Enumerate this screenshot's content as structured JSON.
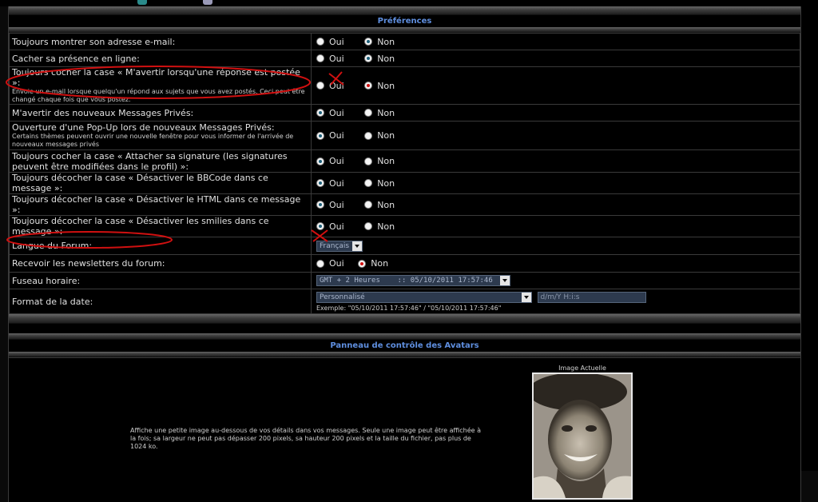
{
  "preferences": {
    "header": "Préférences",
    "rows": [
      {
        "label": "Toujours montrer son adresse e-mail:",
        "desc": "",
        "yes": "Oui",
        "no": "Non",
        "selected": "no"
      },
      {
        "label": "Cacher sa présence en ligne:",
        "desc": "",
        "yes": "Oui",
        "no": "Non",
        "selected": "no"
      },
      {
        "label": "Toujours cocher la case « M'avertir lorsqu'une réponse est postée »:",
        "desc": "Envoie un e-mail lorsque quelqu'un répond aux sujets que vous avez postés. Ceci peut être changé chaque fois que vous postez.",
        "yes": "Oui",
        "no": "Non",
        "selected": "no"
      },
      {
        "label": "M'avertir des nouveaux Messages Privés:",
        "desc": "",
        "yes": "Oui",
        "no": "Non",
        "selected": "yes"
      },
      {
        "label": "Ouverture d'une Pop-Up lors de nouveaux Messages Privés:",
        "desc": "Certains thèmes peuvent ouvrir une nouvelle fenêtre pour vous informer de l'arrivée de nouveaux messages privés",
        "yes": "Oui",
        "no": "Non",
        "selected": "yes"
      },
      {
        "label": "Toujours cocher la case « Attacher sa signature (les signatures peuvent être modifiées dans le profil) »:",
        "desc": "",
        "yes": "Oui",
        "no": "Non",
        "selected": "yes"
      },
      {
        "label": "Toujours décocher la case « Désactiver le BBCode dans ce message »:",
        "desc": "",
        "yes": "Oui",
        "no": "Non",
        "selected": "yes"
      },
      {
        "label": "Toujours décocher la case « Désactiver le HTML dans ce message »:",
        "desc": "",
        "yes": "Oui",
        "no": "Non",
        "selected": "yes"
      },
      {
        "label": "Toujours décocher la case « Désactiver les smilies dans ce message »:",
        "desc": "",
        "yes": "Oui",
        "no": "Non",
        "selected": "yes"
      }
    ],
    "language": {
      "label": "Langue du Forum:",
      "value": "Français"
    },
    "newsletter": {
      "label": "Recevoir les newsletters du forum:",
      "yes": "Oui",
      "no": "Non",
      "selected": "no"
    },
    "timezone": {
      "label": "Fuseau horaire:",
      "value": "GMT + 2 Heures    :: 05/10/2011 17:57:46"
    },
    "dateformat": {
      "label": "Format de la date:",
      "select_value": "Personnalisé",
      "input_value": "d/m/Y H:i:s",
      "example": "Exemple: \"05/10/2011 17:57:46\" / \"05/10/2011 17:57:46\""
    }
  },
  "avatar": {
    "header": "Panneau de contrôle des Avatars",
    "description": "Affiche une petite image au-dessous de vos détails dans vos messages. Seule une image peut être affichée à la fois; sa largeur ne peut pas dépasser 200 pixels, sa hauteur 200 pixels et la taille du fichier, pas plus de 1024 ko.",
    "current_caption": "Image Actuelle"
  },
  "colors": {
    "accent": "#5f8fe0",
    "annotation": "#d01010",
    "radio_selected": "#1d5f7a"
  }
}
